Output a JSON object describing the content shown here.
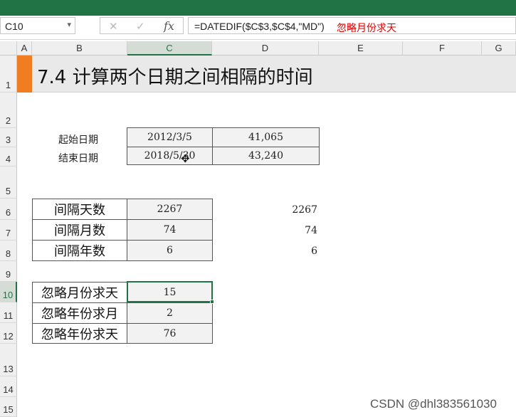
{
  "formula_bar": {
    "name_box": "C10",
    "cancel_glyph": "✕",
    "enter_glyph": "✓",
    "fx_label": "fx",
    "formula": "=DATEDIF($C$3,$C$4,\"MD\")",
    "annotation": "忽略月份求天"
  },
  "columns": [
    "A",
    "B",
    "C",
    "D",
    "E",
    "F",
    "G"
  ],
  "rows": [
    "1",
    "2",
    "3",
    "4",
    "5",
    "6",
    "7",
    "8",
    "9",
    "10",
    "11",
    "12",
    "13",
    "14",
    "15"
  ],
  "selected_cell": "C10",
  "title": "7.4 计算两个日期之间相隔的时间",
  "dates": [
    {
      "label": "起始日期",
      "date": "2012/3/5",
      "serial": "41,065"
    },
    {
      "label": "结束日期",
      "date": "2018/5/30",
      "serial": "43,240"
    }
  ],
  "intervals": [
    {
      "label": "间隔天数",
      "value": "2267",
      "e_value": "2267"
    },
    {
      "label": "间隔月数",
      "value": "74",
      "e_value": "74"
    },
    {
      "label": "间隔年数",
      "value": "6",
      "e_value": "6"
    }
  ],
  "ignore": [
    {
      "label": "忽略月份求天",
      "value": "15"
    },
    {
      "label": "忽略年份求月",
      "value": "2"
    },
    {
      "label": "忽略年份求天",
      "value": "76"
    }
  ],
  "watermark": "CSDN @dhl383561030",
  "colors": {
    "excel_green": "#217346",
    "accent_orange": "#f07d22",
    "annotation_red": "#e00000"
  }
}
